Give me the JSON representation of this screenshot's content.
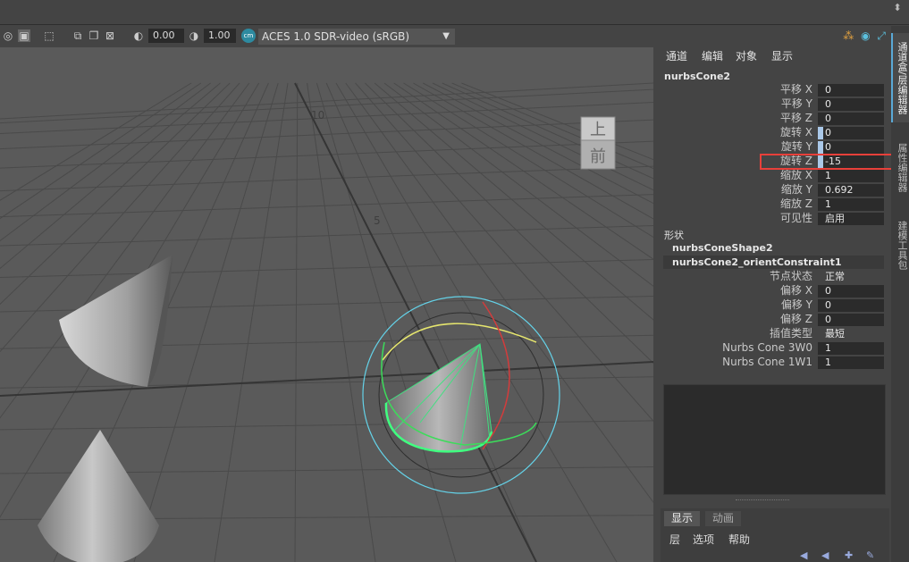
{
  "viewport": {
    "toolbar": {
      "exposure_value": "0.00",
      "gamma_value": "1.00",
      "color_mgmt_badge": "cm",
      "color_space": "ACES 1.0 SDR-video (sRGB)"
    },
    "grid_labels": [
      "10",
      "5"
    ],
    "viewcube": {
      "top": "上",
      "front": "前"
    }
  },
  "channel_box": {
    "menu": [
      "通道",
      "编辑",
      "对象",
      "显示"
    ],
    "object_name": "nurbsCone2",
    "attributes": [
      {
        "label": "平移 X",
        "value": "0",
        "keyed": false
      },
      {
        "label": "平移 Y",
        "value": "0",
        "keyed": false
      },
      {
        "label": "平移 Z",
        "value": "0",
        "keyed": false
      },
      {
        "label": "旋转 X",
        "value": "0",
        "keyed": true
      },
      {
        "label": "旋转 Y",
        "value": "0",
        "keyed": true
      },
      {
        "label": "旋转 Z",
        "value": "-15",
        "keyed": true
      },
      {
        "label": "缩放 X",
        "value": "1",
        "keyed": false
      },
      {
        "label": "缩放 Y",
        "value": "0.692",
        "keyed": false
      },
      {
        "label": "缩放 Z",
        "value": "1",
        "keyed": false
      },
      {
        "label": "可见性",
        "value": "启用",
        "keyed": false
      }
    ],
    "shapes_title": "形状",
    "shapes": [
      "nurbsConeShape2",
      "nurbsCone2_orientConstraint1"
    ],
    "constraint_attributes": [
      {
        "label": "节点状态",
        "value": "正常",
        "plain": true
      },
      {
        "label": "偏移 X",
        "value": "0",
        "plain": false
      },
      {
        "label": "偏移 Y",
        "value": "0",
        "plain": false
      },
      {
        "label": "偏移 Z",
        "value": "0",
        "plain": false
      },
      {
        "label": "插值类型",
        "value": "最短",
        "plain": true
      },
      {
        "label": "Nurbs Cone 3W0",
        "value": "1",
        "plain": false
      },
      {
        "label": "Nurbs Cone 1W1",
        "value": "1",
        "plain": false
      }
    ]
  },
  "side_tabs": [
    "通道盒/层编辑器",
    "属性编辑器",
    "建模工具包"
  ],
  "layer_editor": {
    "tabs": [
      "显示",
      "动画"
    ],
    "menu": [
      "层",
      "选项",
      "帮助"
    ]
  },
  "colors": {
    "highlight": "#e8403a",
    "keyed": "#aac8e8",
    "manip_cyan": "#64d2e8",
    "manip_yellow": "#e6e66e",
    "manip_red": "#d23c3c",
    "manip_green": "#3cdc5a"
  }
}
